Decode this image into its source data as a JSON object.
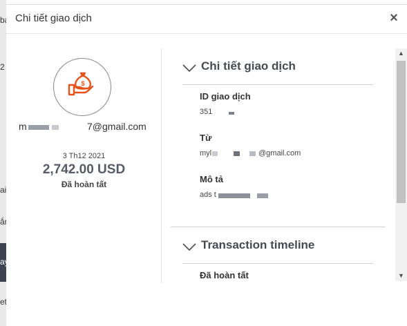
{
  "background": {
    "fragments": [
      "ba",
      "2",
      "ai",
      "ắn",
      "ay",
      "et"
    ]
  },
  "dialog": {
    "title": "Chi tiết giao dịch",
    "close_label": "×"
  },
  "summary": {
    "icon": "money-bag-hand-icon",
    "accent_color": "#e8521a",
    "email_prefix": "m",
    "email_suffix": "7@gmail.com",
    "date": "3 Th12 2021",
    "amount": "2,742.00 USD",
    "status": "Đã hoàn tất"
  },
  "details": {
    "section_title": "Chi tiết giao dịch",
    "fields": [
      {
        "label": "ID giao dịch",
        "value": "351"
      },
      {
        "label": "Từ",
        "value_prefix": "myl",
        "value_suffix": "@gmail.com"
      },
      {
        "label": "Mô tả",
        "value": "ads t"
      }
    ]
  },
  "timeline": {
    "section_title": "Transaction timeline",
    "first_item": "Đã hoàn tất"
  },
  "scrollbar": {
    "up_arrow": "▲",
    "down_arrow": "▼"
  }
}
